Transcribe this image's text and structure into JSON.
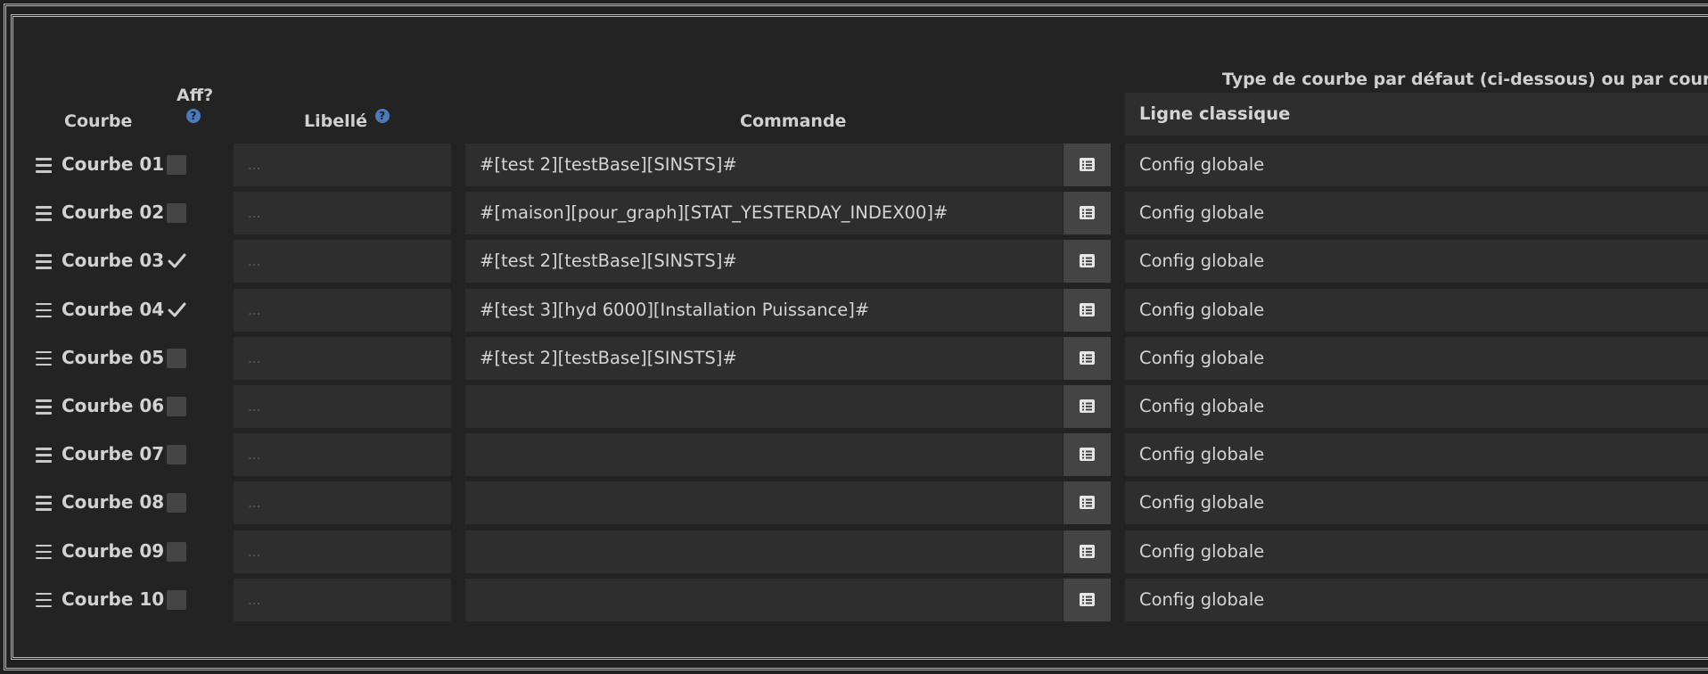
{
  "headers": {
    "courbe": "Courbe",
    "aff": "Aff?",
    "libelle": "Libellé",
    "commande": "Commande",
    "type_title": "Type de courbe par défaut (ci-dessous) ou par courbe"
  },
  "default_type": "Ligne classique",
  "libelle_placeholder": "...",
  "rows": [
    {
      "label": "Courbe 01",
      "checked": false,
      "command": "#[test 2][testBase][SINSTS]#",
      "type": "Config globale"
    },
    {
      "label": "Courbe 02",
      "checked": false,
      "command": "#[maison][pour_graph][STAT_YESTERDAY_INDEX00]#",
      "type": "Config globale"
    },
    {
      "label": "Courbe 03",
      "checked": true,
      "command": "#[test 2][testBase][SINSTS]#",
      "type": "Config globale"
    },
    {
      "label": "Courbe 04",
      "checked": true,
      "command": "#[test 3][hyd 6000][Installation Puissance]#",
      "type": "Config globale"
    },
    {
      "label": "Courbe 05",
      "checked": false,
      "command": "#[test 2][testBase][SINSTS]#",
      "type": "Config globale"
    },
    {
      "label": "Courbe 06",
      "checked": false,
      "command": "",
      "type": "Config globale"
    },
    {
      "label": "Courbe 07",
      "checked": false,
      "command": "",
      "type": "Config globale"
    },
    {
      "label": "Courbe 08",
      "checked": false,
      "command": "",
      "type": "Config globale"
    },
    {
      "label": "Courbe 09",
      "checked": false,
      "command": "",
      "type": "Config globale"
    },
    {
      "label": "Courbe 10",
      "checked": false,
      "command": "",
      "type": "Config globale"
    }
  ]
}
